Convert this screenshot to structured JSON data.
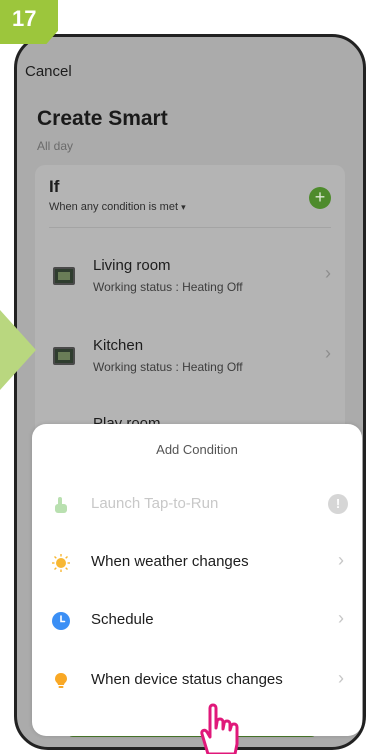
{
  "step_number": "17",
  "header": {
    "cancel_label": "Cancel",
    "title": "Create Smart",
    "subtitle": "All day"
  },
  "condition": {
    "label": "If",
    "match_mode": "When any condition is met",
    "add_icon": "plus-icon"
  },
  "devices": [
    {
      "name": "Living room",
      "status": "Working status : Heating Off"
    },
    {
      "name": "Kitchen",
      "status": "Working status : Heating Off"
    },
    {
      "name": "Play room",
      "status": ""
    }
  ],
  "sheet": {
    "title": "Add Condition",
    "options": [
      {
        "label": "Launch Tap-to-Run",
        "icon": "tap-hand-icon",
        "disabled": true
      },
      {
        "label": "When weather changes",
        "icon": "sun-icon"
      },
      {
        "label": "Schedule",
        "icon": "clock-icon"
      },
      {
        "label": "When device status changes",
        "icon": "lightbulb-icon"
      }
    ]
  },
  "colors": {
    "accent_green": "#9cc63c",
    "add_button": "#4e8b2c",
    "schedule_blue": "#3b8ff5",
    "weather_orange": "#f7b733",
    "bulb_orange": "#f9a825"
  }
}
